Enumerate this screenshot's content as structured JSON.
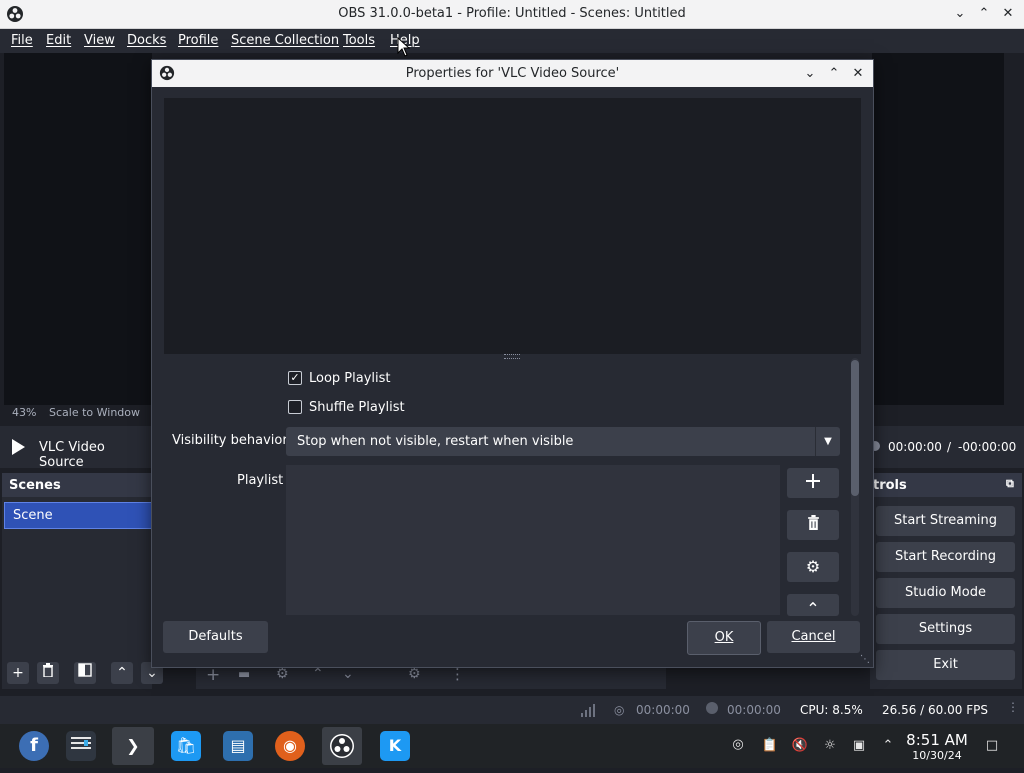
{
  "app": {
    "title": "OBS 31.0.0-beta1 - Profile: Untitled - Scenes: Untitled",
    "window_controls": [
      "minimize",
      "maximize",
      "close"
    ]
  },
  "menu": {
    "items": [
      "File",
      "Edit",
      "View",
      "Docks",
      "Profile",
      "Scene Collection",
      "Tools",
      "Help"
    ]
  },
  "preview": {
    "zoom": "43%",
    "scale_mode": "Scale to Window"
  },
  "source_bar": {
    "source_name": "VLC Video Source",
    "time_current": "00:00:00",
    "time_separator": "/",
    "time_remaining": "-00:00:00"
  },
  "scenes": {
    "title": "Scenes",
    "items": [
      "Scene"
    ]
  },
  "controls": {
    "title": "trols",
    "buttons": [
      "Start Streaming",
      "Start Recording",
      "Studio Mode",
      "Settings",
      "Exit"
    ]
  },
  "status": {
    "stream_time": "00:00:00",
    "record_time": "00:00:00",
    "cpu": "CPU: 8.5%",
    "fps": "26.56 / 60.00 FPS"
  },
  "dialog": {
    "title": "Properties for 'VLC Video Source'",
    "loop_playlist": {
      "label": "Loop Playlist",
      "checked": true
    },
    "shuffle_playlist": {
      "label": "Shuffle Playlist",
      "checked": false
    },
    "visibility": {
      "label": "Visibility behavior",
      "value": "Stop when not visible, restart when visible"
    },
    "playlist_label": "Playlist",
    "defaults_label": "Defaults",
    "ok_label": "OK",
    "cancel_label": "Cancel"
  },
  "taskbar": {
    "clock_time": "8:51 AM",
    "clock_date": "10/30/24",
    "apps": [
      "fedora-icon",
      "settings-icon",
      "terminal-icon",
      "store-icon",
      "files-icon",
      "firefox-icon",
      "obs-icon",
      "kde-icon"
    ]
  }
}
